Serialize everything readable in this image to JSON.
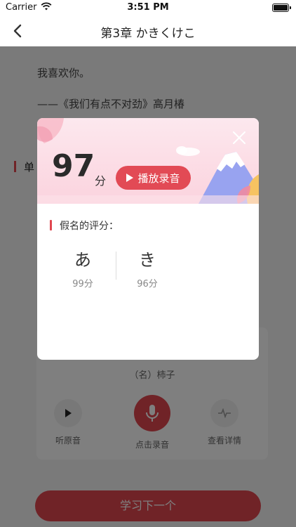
{
  "status": {
    "carrier": "Carrier",
    "time": "3:51 PM"
  },
  "nav": {
    "title": "第3章 かきくけこ"
  },
  "page": {
    "quote_line1": "我喜欢你。",
    "quote_line2": "——《我们有点不对劲》高月椿",
    "section_title": "单",
    "word_meaning": "（名）柿子",
    "actions": [
      "听原音",
      "点击录音",
      "查看详情"
    ],
    "next_button": "学习下一个"
  },
  "modal": {
    "score": "97",
    "score_unit": "分",
    "play_button": "播放录音",
    "kana_section_title": "假名的评分：",
    "kana": [
      {
        "char": "あ",
        "score": "99分"
      },
      {
        "char": "き",
        "score": "96分"
      }
    ]
  },
  "colors": {
    "accent": "#e0464f",
    "header_pink": "#fbd3de"
  }
}
